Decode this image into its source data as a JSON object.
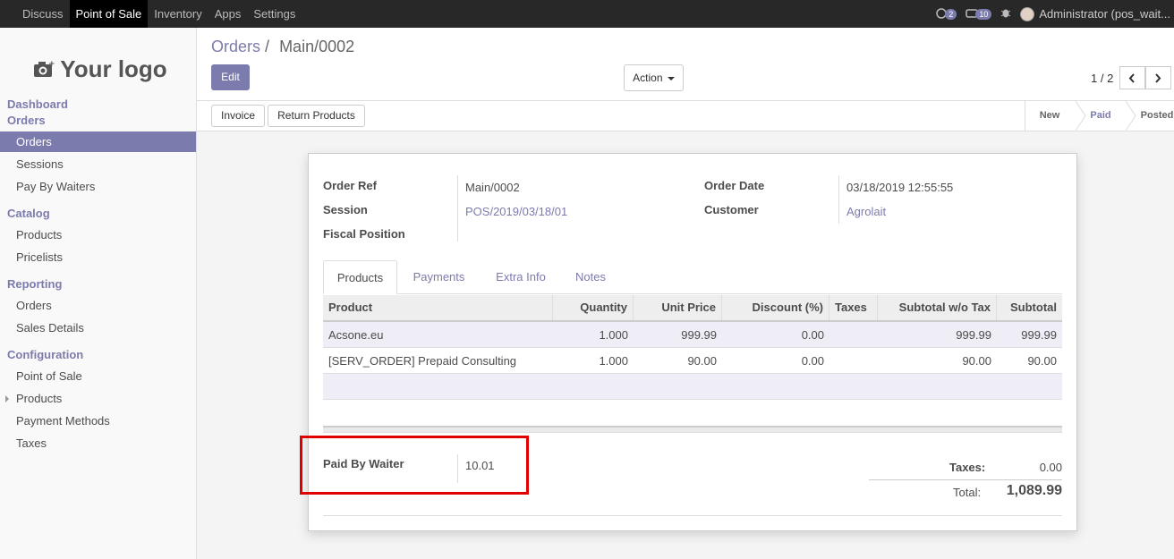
{
  "topbar": {
    "menu": [
      "Discuss",
      "Point of Sale",
      "Inventory",
      "Apps",
      "Settings"
    ],
    "chat_count": "2",
    "activity_count": "10",
    "user": "Administrator (pos_wait..."
  },
  "sidebar": {
    "logo_text": "Your logo",
    "sections": {
      "dashboard": "Dashboard",
      "orders": "Orders",
      "catalog": "Catalog",
      "reporting": "Reporting",
      "configuration": "Configuration"
    },
    "items": {
      "orders": "Orders",
      "sessions": "Sessions",
      "pay_by_waiters": "Pay By Waiters",
      "products": "Products",
      "pricelists": "Pricelists",
      "reporting_orders": "Orders",
      "sales_details": "Sales Details",
      "point_of_sale": "Point of Sale",
      "config_products": "Products",
      "payment_methods": "Payment Methods",
      "taxes": "Taxes"
    }
  },
  "control_panel": {
    "breadcrumb_parent": "Orders",
    "breadcrumb_sep": "/",
    "breadcrumb_current": "Main/0002",
    "edit_label": "Edit",
    "action_label": "Action",
    "pager": "1 / 2"
  },
  "statusbar": {
    "invoice_label": "Invoice",
    "return_label": "Return Products",
    "stages": [
      "New",
      "Paid",
      "Posted"
    ],
    "current_stage": "Paid"
  },
  "form": {
    "order_ref_label": "Order Ref",
    "order_ref": "Main/0002",
    "session_label": "Session",
    "session": "POS/2019/03/18/01",
    "fiscal_position_label": "Fiscal Position",
    "order_date_label": "Order Date",
    "order_date": "03/18/2019 12:55:55",
    "customer_label": "Customer",
    "customer": "Agrolait",
    "tabs": [
      "Products",
      "Payments",
      "Extra Info",
      "Notes"
    ],
    "table": {
      "headers": [
        "Product",
        "Quantity",
        "Unit Price",
        "Discount (%)",
        "Taxes",
        "Subtotal w/o Tax",
        "Subtotal"
      ],
      "rows": [
        [
          "Acsone.eu",
          "1.000",
          "999.99",
          "0.00",
          "",
          "999.99",
          "999.99"
        ],
        [
          "[SERV_ORDER] Prepaid Consulting",
          "1.000",
          "90.00",
          "0.00",
          "",
          "90.00",
          "90.00"
        ]
      ]
    },
    "paid_by_waiter_label": "Paid By Waiter",
    "paid_by_waiter": "10.01",
    "taxes_label": "Taxes:",
    "taxes_value": "0.00",
    "total_label": "Total:",
    "total_value": "1,089.99"
  },
  "colors": {
    "accent": "#7c7bad",
    "highlight": "#e00000",
    "topbar": "#282828"
  }
}
